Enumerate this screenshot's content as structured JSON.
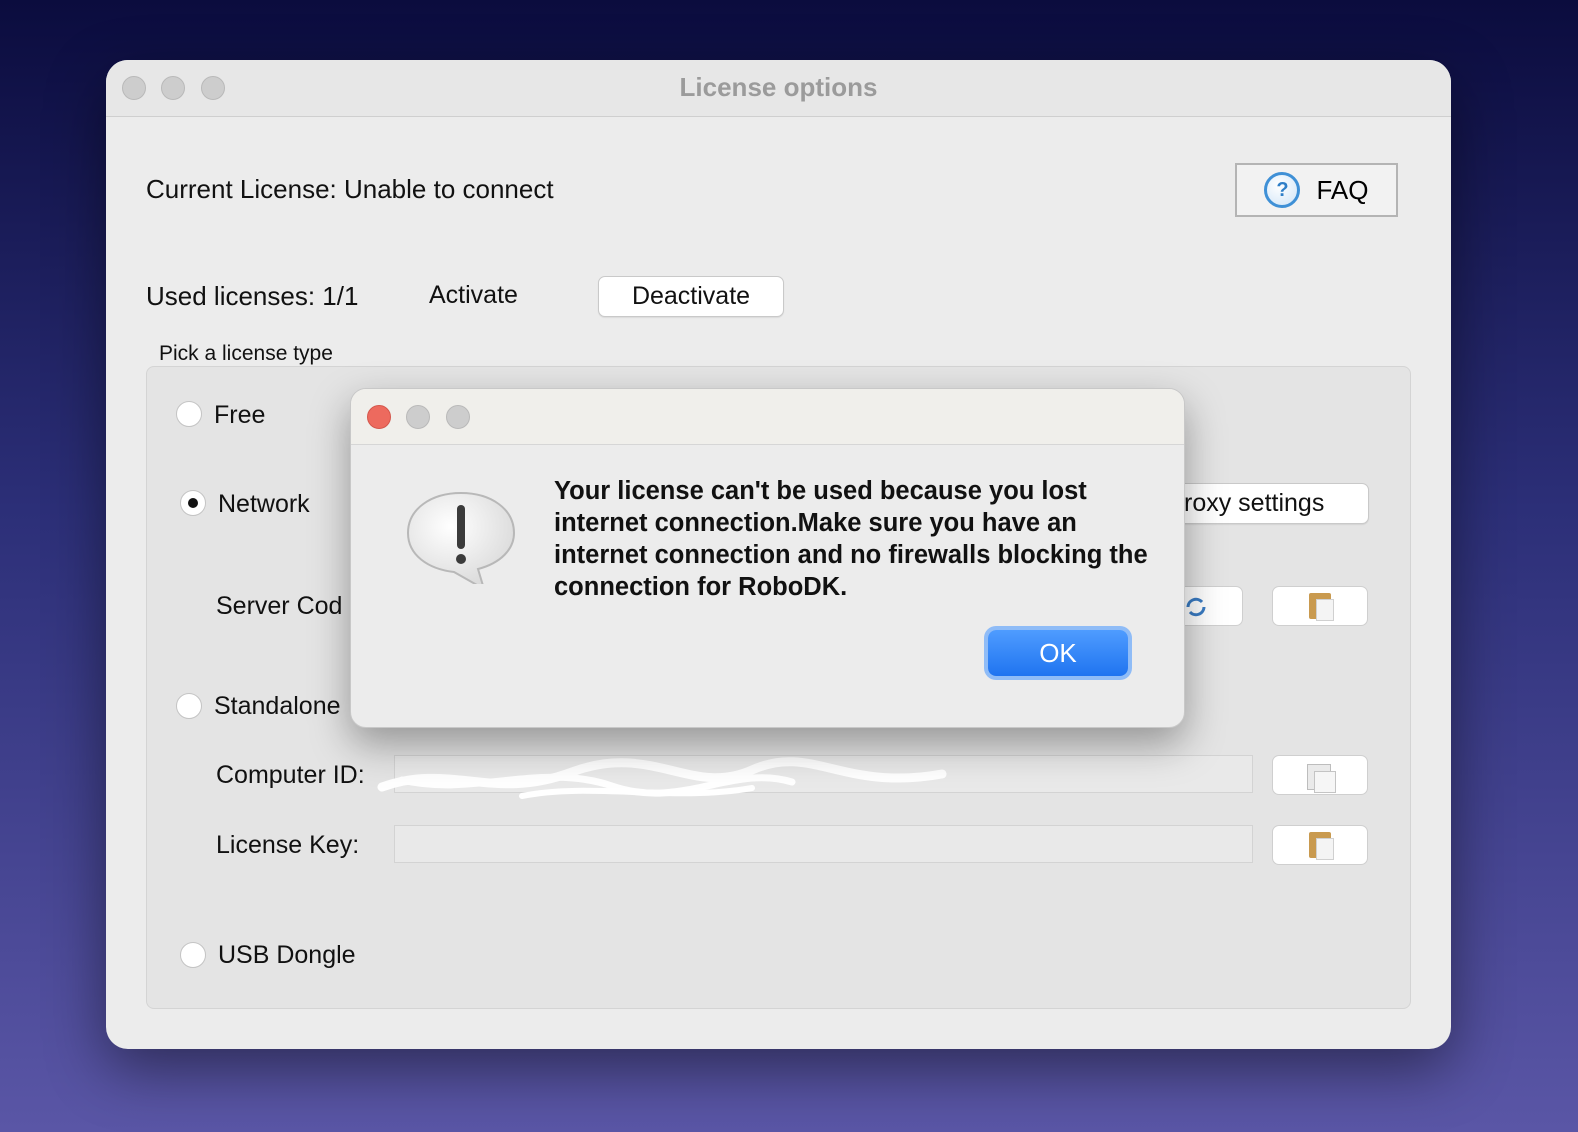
{
  "window": {
    "title": "License options"
  },
  "license": {
    "current": "Current License: Unable to connect",
    "used": "Used licenses: 1/1",
    "activate_label": "Activate",
    "deactivate_label": "Deactivate",
    "faq_label": "FAQ"
  },
  "license_type": {
    "group_title": "Pick a license type",
    "free_label": "Free",
    "network_label": "Network",
    "proxy_label": "roxy settings",
    "server_code_label": "Server Cod",
    "standalone_label": "Standalone",
    "computer_id_label": "Computer ID:",
    "computer_id_value": "",
    "license_key_label": "License Key:",
    "license_key_value": "",
    "usb_label": "USB Dongle",
    "selected": "Network"
  },
  "dialog": {
    "message": "Your license can't be used because you lost internet connection.Make sure you have an internet connection and no firewalls blocking the connection for RoboDK.",
    "ok_label": "OK"
  },
  "colors": {
    "accent": "#1f74f0",
    "close_light": "#ed6a5e"
  },
  "icons": [
    "question-icon",
    "refresh-icon",
    "paste-icon",
    "copy-icon",
    "alert-icon"
  ]
}
